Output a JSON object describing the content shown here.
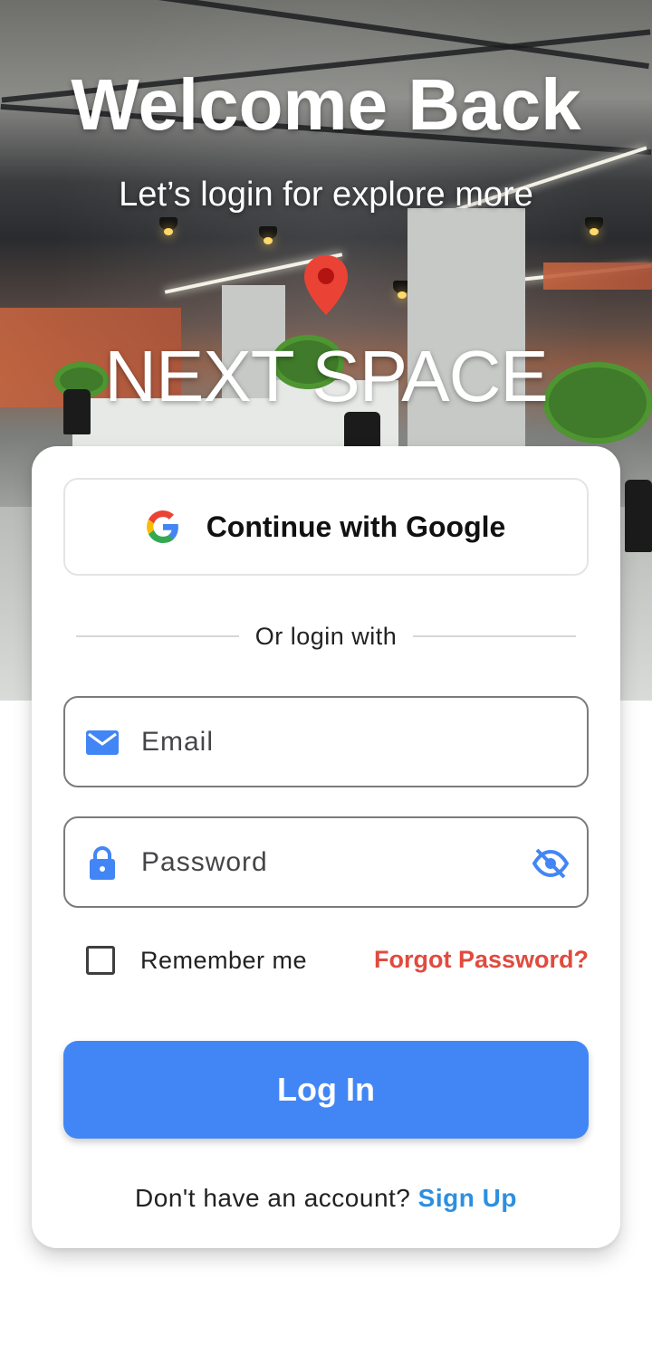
{
  "hero": {
    "title": "Welcome Back",
    "subtitle": "Let’s login for explore more",
    "brand_icon": "location-pin-icon",
    "brand_name": "NEXT SPACE"
  },
  "login_card": {
    "google_button": {
      "icon": "google-logo-icon",
      "label": "Continue with Google"
    },
    "divider_text": "Or login with",
    "email": {
      "icon": "mail-icon",
      "placeholder": "Email"
    },
    "password": {
      "icon": "lock-icon",
      "placeholder": "Password",
      "visibility_icon": "eye-off-icon"
    },
    "remember_me": {
      "label": "Remember me",
      "checked": false
    },
    "forgot_password": "Forgot Password?",
    "login_button": "Log In",
    "signup_prompt": "Don't have an account?",
    "signup_link": "Sign Up"
  },
  "colors": {
    "primary": "#4286f5",
    "forgot_link": "#e04b3e",
    "signup_link": "#2c8fe0",
    "pin": "#ea4335"
  }
}
